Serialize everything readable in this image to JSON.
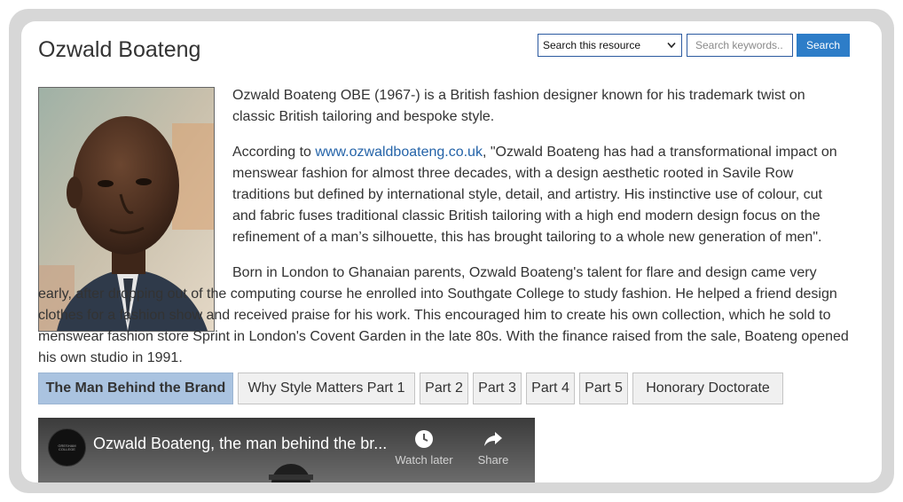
{
  "page": {
    "title": "Ozwald Boateng"
  },
  "search": {
    "scope_selected": "Search this resource",
    "placeholder": "Search keywords..",
    "button_label": "Search"
  },
  "portrait": {
    "description": "portrait-photo"
  },
  "bio": {
    "p1": "Ozwald Boateng OBE (1967-) is a British fashion designer known for his trademark twist on classic British tailoring and bespoke style.",
    "p2_before": "According to ",
    "p2_link": "www.ozwaldboateng.co.uk",
    "p2_after": ", \"Ozwald Boateng has had a transformational impact on menswear fashion for almost three decades, with a design aesthetic rooted in Savile Row traditions but defined by international style, detail, and artistry. His instinctive use of colour, cut and fabric fuses traditional classic British tailoring with a high end modern design focus on the refinement of a man’s silhouette, this has brought tailoring to a whole new generation of men\".",
    "p3": "Born in London to Ghanaian parents, Ozwald Boateng's talent for flare and design came very early, after dropping out of the computing course he enrolled into Southgate College to study fashion. He helped a friend design clothes for a fashion show and received praise for his work. This encouraged him to create his own collection, which he sold to menswear fashion store Sprint in London's Covent Garden in the late 80s. With the finance raised from the sale, Boateng opened his own studio in 1991."
  },
  "tabs": [
    {
      "label": "The Man Behind the Brand",
      "active": true
    },
    {
      "label": "Why Style Matters Part 1",
      "active": false
    },
    {
      "label": "Part 2",
      "active": false
    },
    {
      "label": "Part 3",
      "active": false
    },
    {
      "label": "Part 4",
      "active": false
    },
    {
      "label": "Part 5",
      "active": false
    },
    {
      "label": "Honorary Doctorate",
      "active": false
    }
  ],
  "video": {
    "title": "Ozwald Boateng, the man behind the br...",
    "watch_later_label": "Watch later",
    "share_label": "Share",
    "watch_later_icon": "clock-icon",
    "share_icon": "share-arrow-icon",
    "channel_icon_text": "GRESHAM COLLEGE"
  },
  "colors": {
    "frame": "#d7d7d7",
    "accent_blue": "#2d7dc8",
    "link": "#2463a8",
    "active_tab": "#aac3e0"
  }
}
